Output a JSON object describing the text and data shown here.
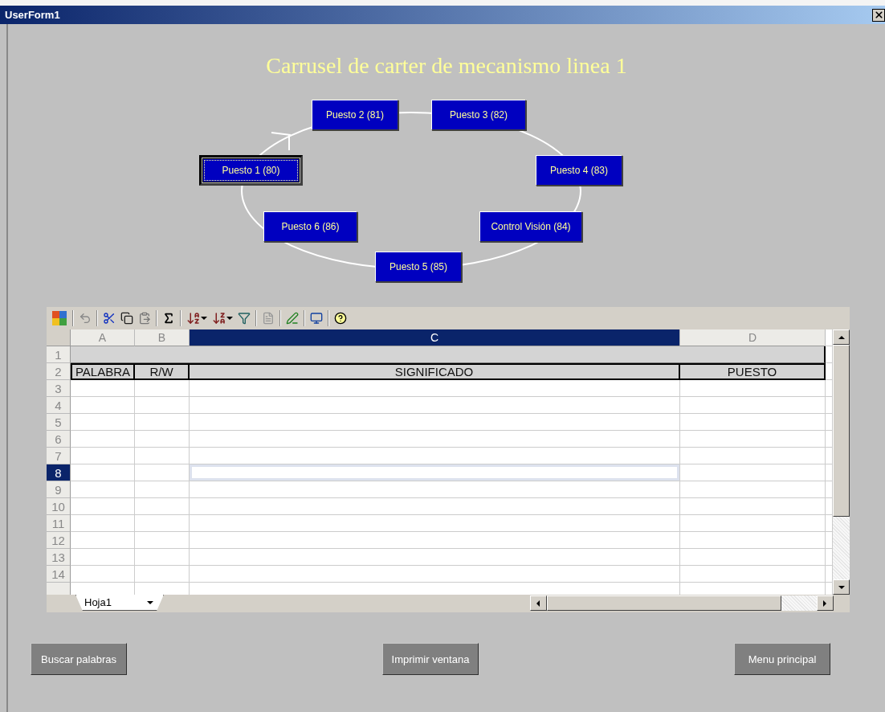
{
  "window": {
    "title": "UserForm1"
  },
  "heading": "Carrusel de carter de mecanismo linea 1",
  "stations": [
    {
      "label": "Puesto 2 (81)",
      "selected": false
    },
    {
      "label": "Puesto  3  (82)",
      "selected": false
    },
    {
      "label": "Puesto 1 (80)",
      "selected": true
    },
    {
      "label": "Puesto 4  (83)",
      "selected": false
    },
    {
      "label": "Puesto 6  (86)",
      "selected": false
    },
    {
      "label": "Control Visión (84)",
      "selected": false
    },
    {
      "label": "Puesto 5 (85)",
      "selected": false
    }
  ],
  "spreadsheet": {
    "columns": [
      {
        "label": "A",
        "selected": false
      },
      {
        "label": "B",
        "selected": false
      },
      {
        "label": "C",
        "selected": true
      },
      {
        "label": "D",
        "selected": false
      }
    ],
    "rows": [
      {
        "number": "1",
        "selected": false,
        "kind": "band"
      },
      {
        "number": "2",
        "selected": false,
        "kind": "header",
        "cells": [
          "PALABRA",
          "R/W",
          "SIGNIFICADO",
          "PUESTO"
        ]
      },
      {
        "number": "3",
        "selected": false,
        "kind": "plain"
      },
      {
        "number": "4",
        "selected": false,
        "kind": "plain"
      },
      {
        "number": "5",
        "selected": false,
        "kind": "plain"
      },
      {
        "number": "6",
        "selected": false,
        "kind": "plain"
      },
      {
        "number": "7",
        "selected": false,
        "kind": "plain"
      },
      {
        "number": "8",
        "selected": true,
        "kind": "plain"
      },
      {
        "number": "9",
        "selected": false,
        "kind": "plain"
      },
      {
        "number": "10",
        "selected": false,
        "kind": "plain"
      },
      {
        "number": "11",
        "selected": false,
        "kind": "plain"
      },
      {
        "number": "12",
        "selected": false,
        "kind": "plain"
      },
      {
        "number": "13",
        "selected": false,
        "kind": "plain"
      },
      {
        "number": "14",
        "selected": false,
        "kind": "plain"
      }
    ],
    "sheet_tab": "Hoja1"
  },
  "buttons": [
    "Buscar palabras",
    "Imprimir ventana",
    "Menu principal"
  ]
}
